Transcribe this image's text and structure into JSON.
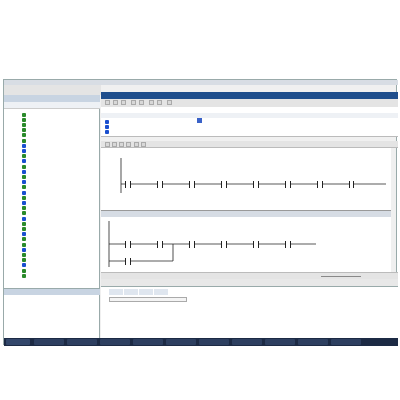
{
  "window": {
    "title": "",
    "accent": "#1f4e8c"
  },
  "menu": {
    "items": [
      "",
      "",
      "",
      "",
      "",
      "",
      "",
      "",
      "",
      "",
      ""
    ]
  },
  "project_tree": {
    "header": "",
    "items": [
      {
        "label": "",
        "color": "#2a8a2a"
      },
      {
        "label": "",
        "color": "#2a8a2a"
      },
      {
        "label": "",
        "color": "#2a8a2a"
      },
      {
        "label": "",
        "color": "#2a8a2a"
      },
      {
        "label": "",
        "color": "#2a8a2a"
      },
      {
        "label": "",
        "color": "#2a8a2a"
      },
      {
        "label": "",
        "color": "#1a4fcf"
      },
      {
        "label": "",
        "color": "#1a4fcf"
      },
      {
        "label": "",
        "color": "#2a8a2a"
      },
      {
        "label": "",
        "color": "#1a4fcf"
      },
      {
        "label": "",
        "color": "#2a8a2a"
      },
      {
        "label": "",
        "color": "#1a4fcf"
      },
      {
        "label": "",
        "color": "#2a8a2a"
      },
      {
        "label": "",
        "color": "#1a4fcf"
      },
      {
        "label": "",
        "color": "#2a8a2a"
      },
      {
        "label": "",
        "color": "#1a4fcf"
      },
      {
        "label": "",
        "color": "#2a8a2a"
      },
      {
        "label": "",
        "color": "#1a4fcf"
      },
      {
        "label": "",
        "color": "#2a8a2a"
      },
      {
        "label": "",
        "color": "#2a8a2a"
      },
      {
        "label": "",
        "color": "#1a4fcf"
      },
      {
        "label": "",
        "color": "#2a8a2a"
      },
      {
        "label": "",
        "color": "#2a8a2a"
      },
      {
        "label": "",
        "color": "#1a4fcf"
      },
      {
        "label": "",
        "color": "#2a8a2a"
      },
      {
        "label": "",
        "color": "#2a8a2a"
      },
      {
        "label": "",
        "color": "#1a4fcf"
      },
      {
        "label": "",
        "color": "#2a8a2a"
      },
      {
        "label": "",
        "color": "#2a8a2a"
      },
      {
        "label": "",
        "color": "#1a4fcf"
      },
      {
        "label": "",
        "color": "#2a8a2a"
      },
      {
        "label": "",
        "color": "#2a8a2a"
      }
    ]
  },
  "details_panel": {
    "header": "",
    "col1": "",
    "col2": ""
  },
  "interface_table": {
    "title": "",
    "columns": [
      "",
      "",
      "",
      ""
    ],
    "rows": [
      "",
      "",
      "",
      ""
    ]
  },
  "networks": [
    {
      "title": "",
      "tags_top": [
        "",
        "",
        "",
        "",
        "",
        "",
        "",
        ""
      ],
      "tags_bottom": [
        "",
        "",
        "",
        "",
        "",
        "",
        "",
        ""
      ]
    },
    {
      "title": "",
      "tags_top": [
        "",
        "",
        "",
        "",
        "",
        ""
      ],
      "tags_bottom": [
        "",
        "",
        "",
        "",
        "",
        ""
      ],
      "branch_top": "",
      "branch_bottom": ""
    }
  ],
  "zoom": {
    "value": ""
  },
  "inspector": {
    "tabs": [
      "",
      "",
      "",
      ""
    ],
    "field": "",
    "section_title": "",
    "text_line1": "",
    "text_line2": ""
  },
  "properties_tabs": [
    "",
    "",
    ""
  ],
  "taskbar": {
    "start": "",
    "items": [
      "",
      "",
      "",
      "",
      "",
      "",
      "",
      "",
      "",
      ""
    ],
    "clock": ""
  }
}
